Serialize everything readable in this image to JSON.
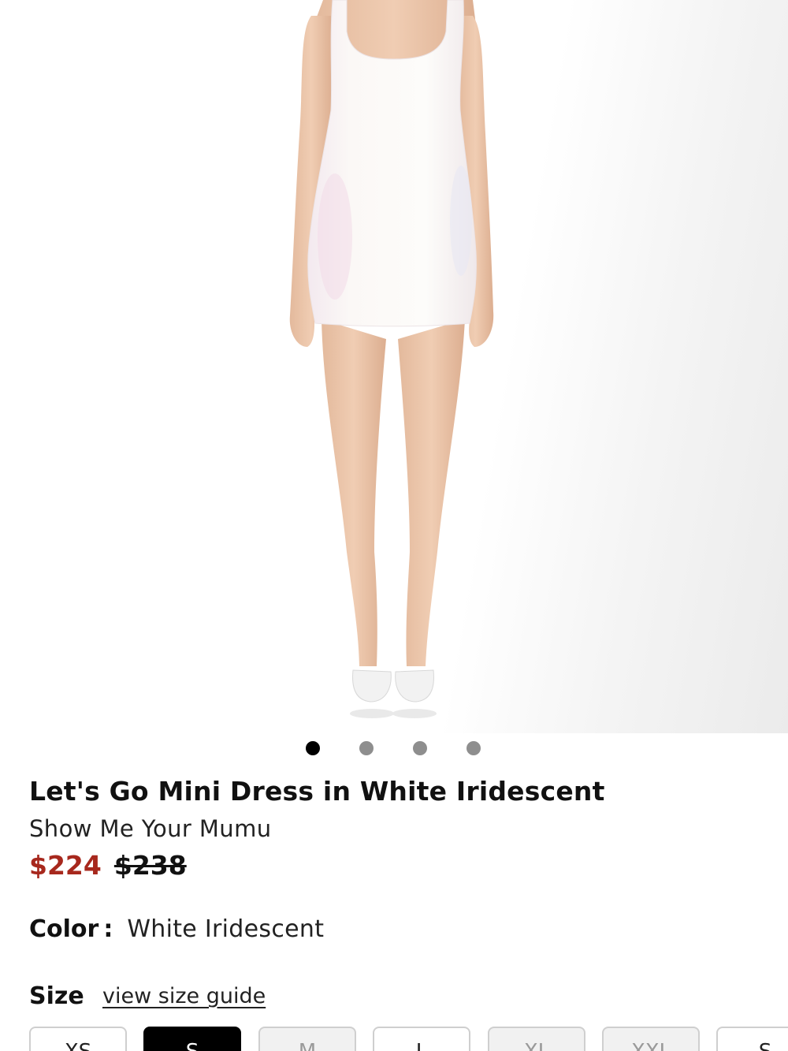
{
  "product": {
    "title": "Let's Go Mini Dress in White Iridescent",
    "brand": "Show Me Your Mumu",
    "sale_price": "$224",
    "original_price": "$238",
    "image_alt": "white-sequin-mini-dress-photo"
  },
  "carousel": {
    "total": 4,
    "active_index": 0
  },
  "color": {
    "label": "Color",
    "separator": ":",
    "value": "White Iridescent"
  },
  "size": {
    "label": "Size",
    "guide_link": "view size guide",
    "options": [
      {
        "label": "XS",
        "state": "available"
      },
      {
        "label": "S",
        "state": "selected"
      },
      {
        "label": "M",
        "state": "unavailable"
      },
      {
        "label": "L",
        "state": "available"
      },
      {
        "label": "XL",
        "state": "unavailable"
      },
      {
        "label": "XXL",
        "state": "unavailable"
      },
      {
        "label": "S",
        "state": "available"
      }
    ]
  },
  "colors": {
    "sale_price": "#a7281d",
    "selected_size_bg": "#000000",
    "active_dot": "#000000",
    "inactive_dot": "#8e8e8e"
  }
}
